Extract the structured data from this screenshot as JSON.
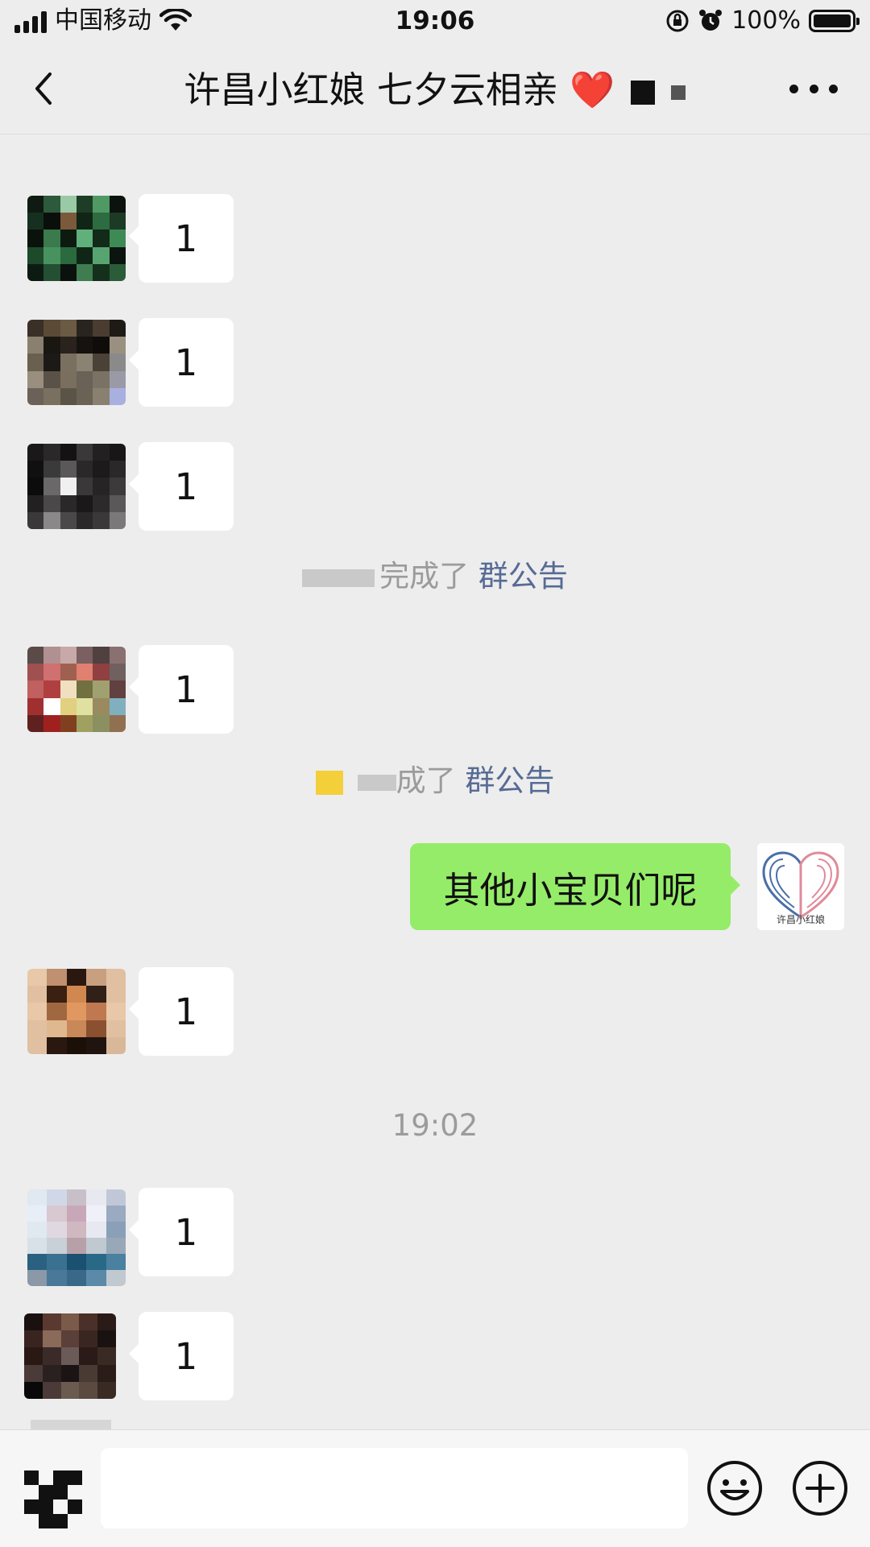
{
  "status_bar": {
    "carrier": "中国移动",
    "time": "19:06",
    "battery": "100%",
    "battery_level": 1.0
  },
  "nav": {
    "title": "许昌小红娘 七夕云相亲",
    "title_emoji": "❤️",
    "back_icon": "chevron-left-icon",
    "more_icon": "more-dots-icon"
  },
  "messages": [
    {
      "type": "left",
      "text": "1"
    },
    {
      "type": "left",
      "text": "1"
    },
    {
      "type": "left",
      "text": "1"
    },
    {
      "type": "system",
      "suffix": "完成了",
      "link": "群公告"
    },
    {
      "type": "left",
      "text": "1"
    },
    {
      "type": "system",
      "suffix": "成了",
      "link": "群公告"
    },
    {
      "type": "right",
      "text": "其他小宝贝们呢",
      "avatar_caption": "许昌小红娘"
    },
    {
      "type": "left",
      "text": "1"
    },
    {
      "type": "time",
      "text": "19:02"
    },
    {
      "type": "left",
      "text": "1"
    },
    {
      "type": "left",
      "text": "1"
    }
  ],
  "input": {
    "voice_icon": "voice-icon",
    "emoji_icon": "emoji-icon",
    "plus_icon": "plus-icon",
    "placeholder": ""
  }
}
